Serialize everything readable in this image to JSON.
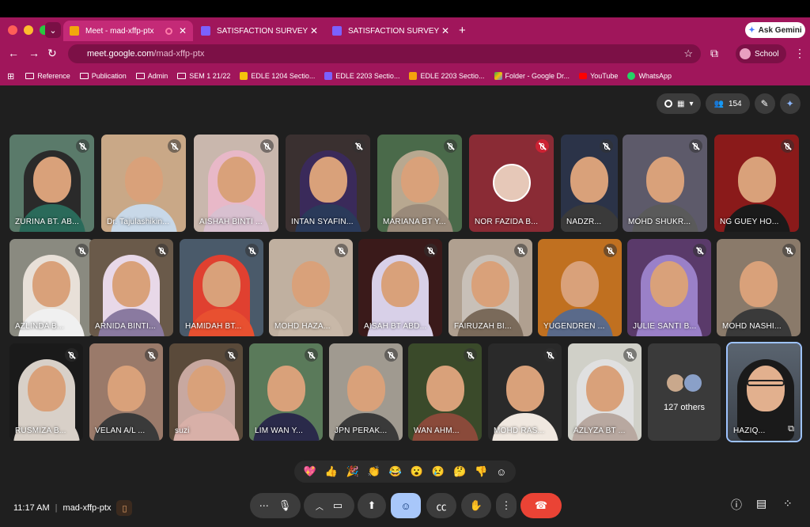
{
  "browser": {
    "tabs": [
      {
        "label": "Meet - mad-xffp-ptx",
        "active": true
      },
      {
        "label": "SATISFACTION SURVEY",
        "active": false
      },
      {
        "label": "SATISFACTION SURVEY",
        "active": false
      }
    ],
    "ask_gemini": "Ask Gemini",
    "url_host": "meet.google.com",
    "url_path": "/mad-xffp-ptx",
    "profile": "School",
    "bookmarks": [
      "Reference",
      "Publication",
      "Admin",
      "SEM 1 21/22",
      "EDLE 1204 Sectio...",
      "EDLE 2203 Sectio...",
      "EDLE 2203 Sectio...",
      "Folder - Google Dr...",
      "YouTube",
      "WhatsApp"
    ]
  },
  "meet": {
    "participant_count": "154",
    "participants": [
      {
        "name": "ZURINA BT. AB..."
      },
      {
        "name": "Dr. Tajulashikin..."
      },
      {
        "name": "AISHAH BINTI ..."
      },
      {
        "name": "INTAN SYAFIN..."
      },
      {
        "name": "MARIANA BT Y..."
      },
      {
        "name": "NOR FAZIDA B..."
      },
      {
        "name": "NADZR..."
      },
      {
        "name": "MOHD SHUKR..."
      },
      {
        "name": "NG GUEY HO..."
      },
      {
        "name": "AZLINDA B..."
      },
      {
        "name": "ARNIDA BINTI..."
      },
      {
        "name": "HAMIDAH BT..."
      },
      {
        "name": "MOHD HAZA..."
      },
      {
        "name": "AISAH BT ABD..."
      },
      {
        "name": "FAIRUZAH BI..."
      },
      {
        "name": "YUGENDREN ..."
      },
      {
        "name": "JULIE SANTI B..."
      },
      {
        "name": "MOHD NASHI..."
      },
      {
        "name": "RUSMIZA B..."
      },
      {
        "name": "VELAN A/L ..."
      },
      {
        "name": "suzi"
      },
      {
        "name": "LIM WAN Y..."
      },
      {
        "name": "JPN PERAK..."
      },
      {
        "name": "WAN AHM..."
      },
      {
        "name": "MOHD RAS..."
      },
      {
        "name": "AZLYZA BT ..."
      }
    ],
    "others_label": "127 others",
    "self_name": "HAZIQ...",
    "reactions": [
      "💖",
      "👍",
      "🎉",
      "👏",
      "😂",
      "😮",
      "😢",
      "🤔",
      "👎",
      "☺"
    ],
    "time": "11:17 AM",
    "meeting_code": "mad-xffp-ptx"
  },
  "colors": {
    "chrome": "#a0165b",
    "meet_bg": "#1f1f1f",
    "end_call": "#ea4335",
    "reaction_active": "#a8c7fa"
  }
}
